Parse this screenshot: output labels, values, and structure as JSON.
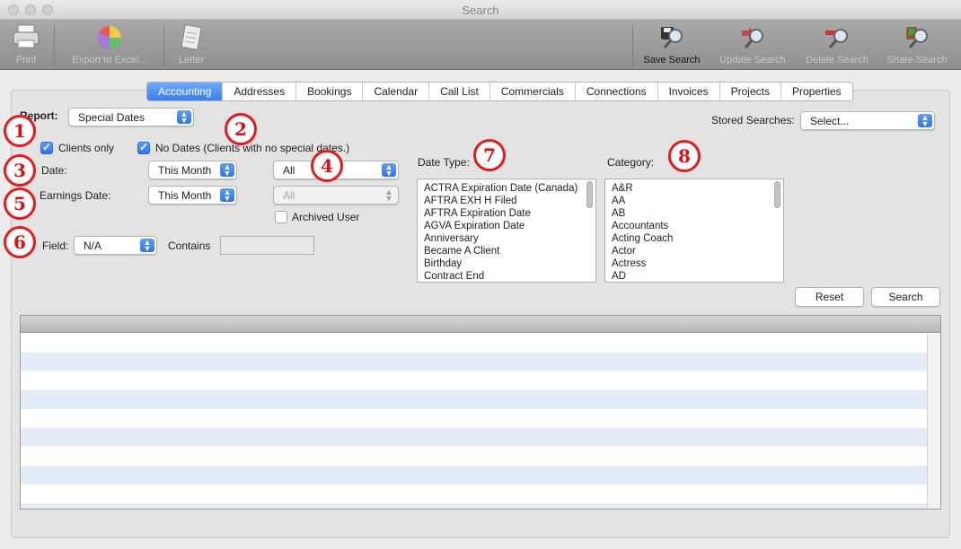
{
  "window": {
    "title": "Search"
  },
  "toolbar": {
    "print": "Print",
    "export": "Export to Excel...",
    "letter": "Letter",
    "save_search": "Save Search",
    "update_search": "Update Search",
    "delete_search": "Delete Search",
    "share_search": "Share Search"
  },
  "tabs": [
    "Accounting",
    "Addresses",
    "Bookings",
    "Calendar",
    "Call List",
    "Commercials",
    "Connections",
    "Invoices",
    "Projects",
    "Properties"
  ],
  "form": {
    "report_label": "Report:",
    "report_value": "Special Dates",
    "stored_searches_label": "Stored Searches:",
    "stored_searches_value": "Select...",
    "clients_only_label": "Clients only",
    "no_dates_label": "No Dates (Clients with no special dates.)",
    "date_label": "Date:",
    "date_value": "This Month",
    "all_value": "All",
    "earnings_date_label": "Earnings Date:",
    "earnings_date_value": "This Month",
    "all_disabled_value": "All",
    "archived_user_label": "Archived User",
    "field_label": "Field:",
    "field_value": "N/A",
    "contains_label": "Contains",
    "date_type_label": "Date Type:",
    "category_label": "Category:",
    "reset_label": "Reset",
    "search_label": "Search"
  },
  "date_types": [
    "ACTRA Expiration Date (Canada)",
    "AFTRA EXH H Filed",
    "AFTRA Expiration Date",
    "AGVA Expiration Date",
    "Anniversary",
    "Became A Client",
    "Birthday",
    "Contract End"
  ],
  "categories": [
    "A&R",
    "AA",
    "AB",
    "Accountants",
    "Acting Coach",
    "Actor",
    "Actress",
    "AD"
  ],
  "annotations": [
    "1",
    "2",
    "3",
    "4",
    "5",
    "6",
    "7",
    "8"
  ],
  "colors": {
    "accent": "#3a7ff0",
    "annotation_red": "#e31b1b",
    "row_alt": "#e4ecf7"
  }
}
